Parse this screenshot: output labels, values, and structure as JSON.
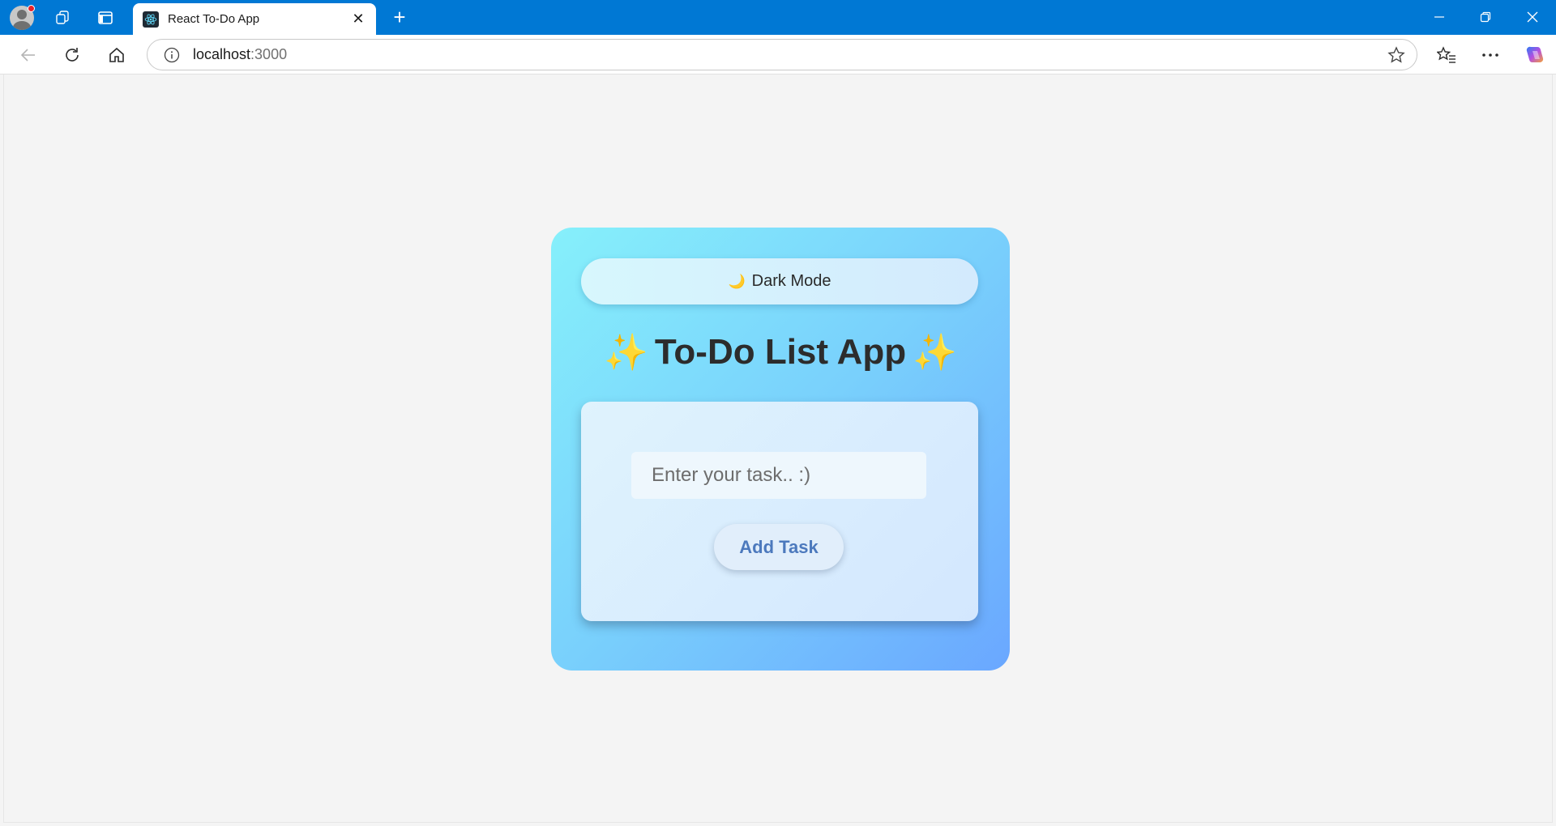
{
  "browser": {
    "tab_title": "React To-Do App",
    "tab_close": "✕",
    "new_tab": "+",
    "url_host": "localhost",
    "url_port": ":3000"
  },
  "icons": {
    "profile": "profile-avatar-icon",
    "workspaces": "workspaces-icon",
    "tab_actions": "vertical-tabs-icon",
    "favicon": "react-logo-icon",
    "back": "back-arrow-icon",
    "refresh": "refresh-icon",
    "home": "home-icon",
    "info": "site-info-icon",
    "favorite": "star-icon",
    "favorites": "favorites-icon",
    "more": "more-icon",
    "copilot": "copilot-icon"
  },
  "app": {
    "mode_label": "Dark Mode",
    "mode_icon": "🌙",
    "title": "To-Do List App",
    "title_sparkle": "✨",
    "input_placeholder": "Enter your task.. :)",
    "input_value": "",
    "add_button": "Add Task"
  },
  "colors": {
    "titlebar": "#0078d4",
    "card_gradient_start": "#86f0fb",
    "card_gradient_end": "#6aa7ff",
    "add_button_text": "#4c79bd",
    "sparkle": "#f6c21c"
  }
}
